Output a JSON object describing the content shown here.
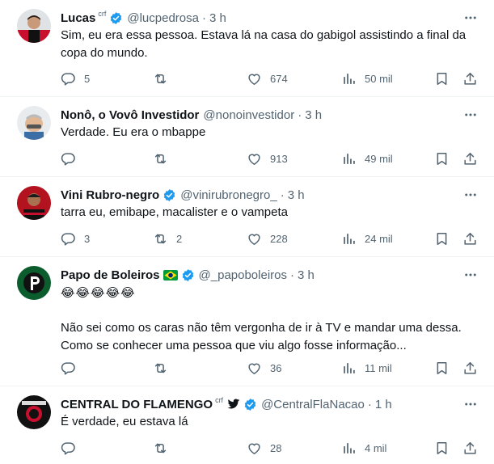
{
  "icons": {
    "reply": "reply-icon",
    "retweet": "retweet-icon",
    "like": "like-icon",
    "views": "views-icon",
    "bookmark": "bookmark-icon",
    "share": "share-icon",
    "more": "more-icon",
    "verified": "verified-badge-icon"
  },
  "colors": {
    "verified_blue": "#1d9bf0",
    "text_primary": "#0f1419",
    "text_secondary": "#536471",
    "divider": "#eff3f4"
  },
  "tweets": [
    {
      "name": "Lucas",
      "affiliate": "crf",
      "handle": "@lucpedrosa",
      "time": "3 h",
      "lines": [
        "Sim, eu era essa pessoa. Estava lá na casa do gabigol assistindo a final da",
        "copa do mundo."
      ],
      "replies": "5",
      "retweets": "",
      "likes": "674",
      "views": "50 mil"
    },
    {
      "name": "Nonô, o Vovô Investidor",
      "handle": "@nonoinvestidor",
      "time": "3 h",
      "lines": [
        "Verdade. Eu era o mbappe"
      ],
      "replies": "",
      "retweets": "",
      "likes": "913",
      "views": "49 mil"
    },
    {
      "name": "Vini Rubro-negro",
      "handle": "@vinirubronegro_",
      "time": "3 h",
      "lines": [
        "tarra eu, emibape, macalister e o vampeta"
      ],
      "replies": "3",
      "retweets": "2",
      "likes": "228",
      "views": "24 mil"
    },
    {
      "name": "Papo de Boleiros",
      "handle": "@_papoboleiros",
      "time": "3 h",
      "emoji": "😂😂😂😂😂",
      "lines": [
        "Não sei como os caras não têm vergonha de ir à TV e mandar uma dessa.",
        "Como se conhecer uma pessoa que viu algo fosse informação..."
      ],
      "replies": "",
      "retweets": "",
      "likes": "36",
      "views": "11 mil"
    },
    {
      "name": "CENTRAL DO FLAMENGO",
      "affiliate": "crf",
      "handle": "@CentralFlaNacao",
      "time": "1 h",
      "lines": [
        "É verdade, eu estava lá"
      ],
      "replies": "",
      "retweets": "",
      "likes": "28",
      "views": "4 mil"
    }
  ]
}
